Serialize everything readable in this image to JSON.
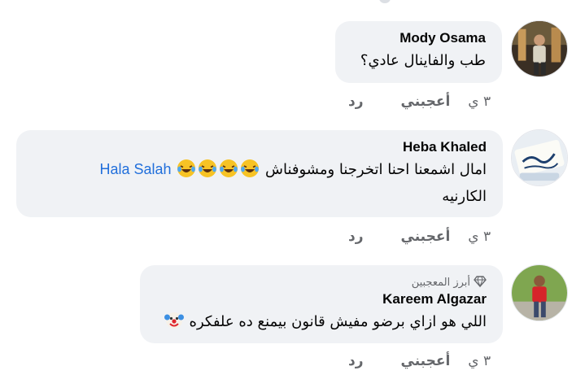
{
  "comments": [
    {
      "author": "Mody Osama",
      "badge": "",
      "text": "طب والفاينال عادي؟",
      "mention": "",
      "tail": "",
      "time": "٣ ي",
      "like_label": "أعجبني",
      "reply_label": "رد"
    },
    {
      "author": "Heba Khaled",
      "badge": "",
      "text": "امال اشمعنا احنا اتخرجنا ومشوفناش",
      "mention": "Hala Salah",
      "tail": "الكارنيه",
      "emojis": [
        "laughing-tears-emoji",
        "laughing-tears-emoji",
        "laughing-tears-emoji",
        "laughing-tears-emoji"
      ],
      "time": "٣ ي",
      "like_label": "أعجبني",
      "reply_label": "رد"
    },
    {
      "author": "Kareem Algazar",
      "badge": "أبرز المعجبين",
      "text": "اللي هو ازاي برضو مفيش قانون بيمنع ده علفكره",
      "mention": "",
      "tail": "",
      "emojis": [
        "clown-emoji"
      ],
      "time": "٣ ي",
      "like_label": "أعجبني",
      "reply_label": "رد"
    }
  ],
  "icons": {
    "badge": "diamond-icon"
  },
  "colors": {
    "bubble": "#f0f2f5",
    "mention": "#216fdb",
    "meta": "#65676b"
  }
}
